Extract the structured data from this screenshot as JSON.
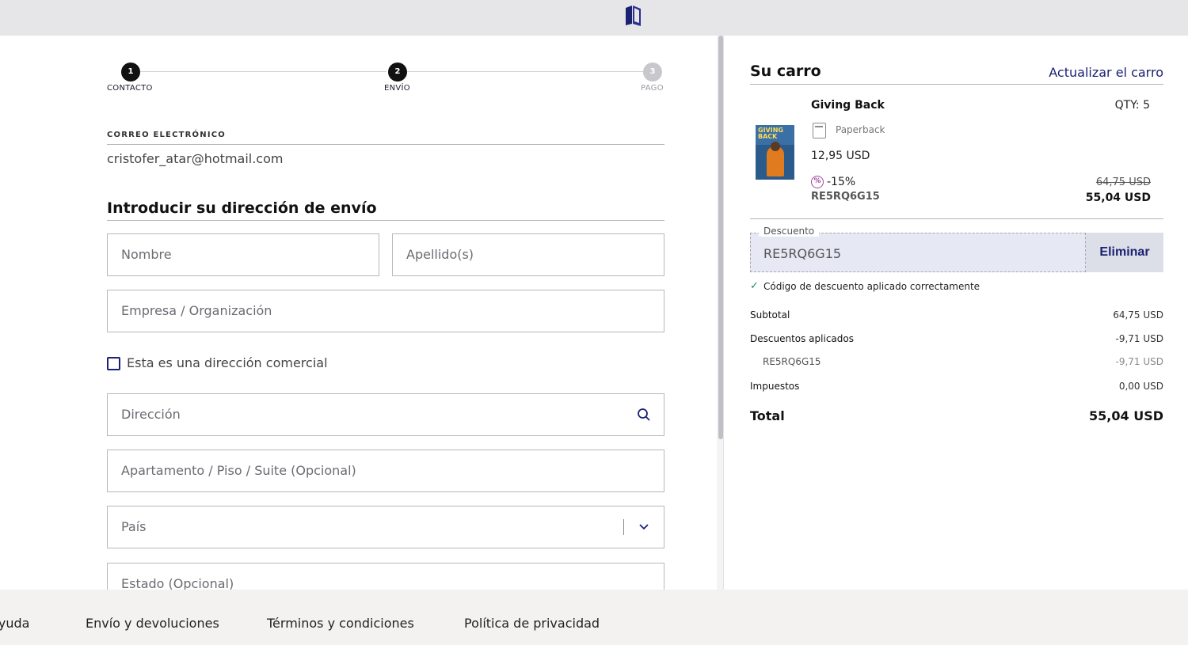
{
  "stepper": {
    "steps": [
      {
        "number": "1",
        "label": "CONTACTO"
      },
      {
        "number": "2",
        "label": "ENVÍO"
      },
      {
        "number": "3",
        "label": "PAGO"
      }
    ]
  },
  "contact": {
    "email_label": "CORREO ELECTRÓNICO",
    "email_value": "cristofer_atar@hotmail.com"
  },
  "shipping": {
    "title": "Introducir su dirección de envío",
    "first_name_placeholder": "Nombre",
    "last_name_placeholder": "Apellido(s)",
    "company_placeholder": "Empresa / Organización",
    "business_checkbox_label": "Esta es una dirección comercial",
    "address_placeholder": "Dirección",
    "apartment_placeholder": "Apartamento / Piso / Suite (Opcional)",
    "country_placeholder": "País",
    "state_placeholder": "Estado (Opcional)"
  },
  "cart": {
    "title": "Su carro",
    "update_link": "Actualizar el carro",
    "item": {
      "name": "Giving Back",
      "cover_text": "GIVING BACK",
      "qty": "QTY: 5",
      "format": "Paperback",
      "unit_price": "12,95 USD",
      "discount_pct": "-15%",
      "discount_code": "RE5RQ6G15",
      "original_total": "64,75 USD",
      "discounted_total": "55,04 USD"
    },
    "discount": {
      "legend": "Descuento",
      "value": "RE5RQ6G15",
      "remove_button": "Eliminar",
      "success_message": "Código de descuento aplicado correctamente"
    },
    "summary": {
      "subtotal_label": "Subtotal",
      "subtotal_value": "64,75 USD",
      "discounts_label": "Descuentos aplicados",
      "discounts_value": "-9,71 USD",
      "code_label": "RE5RQ6G15",
      "code_value": "-9,71 USD",
      "taxes_label": "Impuestos",
      "taxes_value": "0,00 USD",
      "total_label": "Total",
      "total_value": "55,04 USD"
    }
  },
  "footer": {
    "links": [
      "Ayuda",
      "Envío y devoluciones",
      "Términos y condiciones",
      "Política de privacidad"
    ]
  },
  "colors": {
    "brand": "#1c2270",
    "success": "#1e8a5a",
    "discount": "#a04a9e"
  }
}
